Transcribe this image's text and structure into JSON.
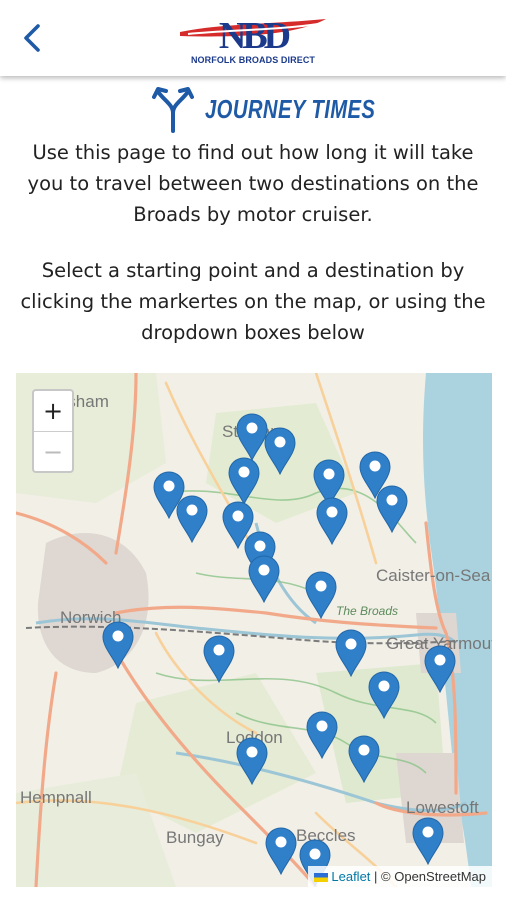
{
  "header": {
    "back_icon": "chevron-left-icon",
    "logo_letters": "NBD",
    "logo_name": "NORFOLK BROADS DIRECT",
    "colors": {
      "brand_blue": "#1b3a8c",
      "brand_red": "#d62b2b"
    }
  },
  "page": {
    "heading_icon": "split-arrows-icon",
    "title": "JOURNEY TIMES",
    "intro": "Use this page to find out how long it will take you to travel between two destinations on the Broads by motor cruiser.",
    "instructions": "Select a starting point and a destination by clicking the markertes on the map, or using the dropdown boxes below"
  },
  "map": {
    "zoom_in_label": "+",
    "zoom_out_label": "−",
    "marker_color": "#2f7fc9",
    "marker_count": 27,
    "place_labels": {
      "aylsham": "Aylsham",
      "stalham": "Stalham",
      "caister": "Caister-on-Sea",
      "norwich": "Norwich",
      "the_broads": "The Broads",
      "great_yarmouth": "Great Yarmouth",
      "loddon": "Loddon",
      "beccles": "Beccles",
      "bungay": "Bungay",
      "hempnall": "Hempnall",
      "lowestoft": "Lowestoft"
    },
    "attribution": {
      "leaflet": "Leaflet",
      "separator": " | ",
      "osm": "© OpenStreetMap"
    }
  }
}
